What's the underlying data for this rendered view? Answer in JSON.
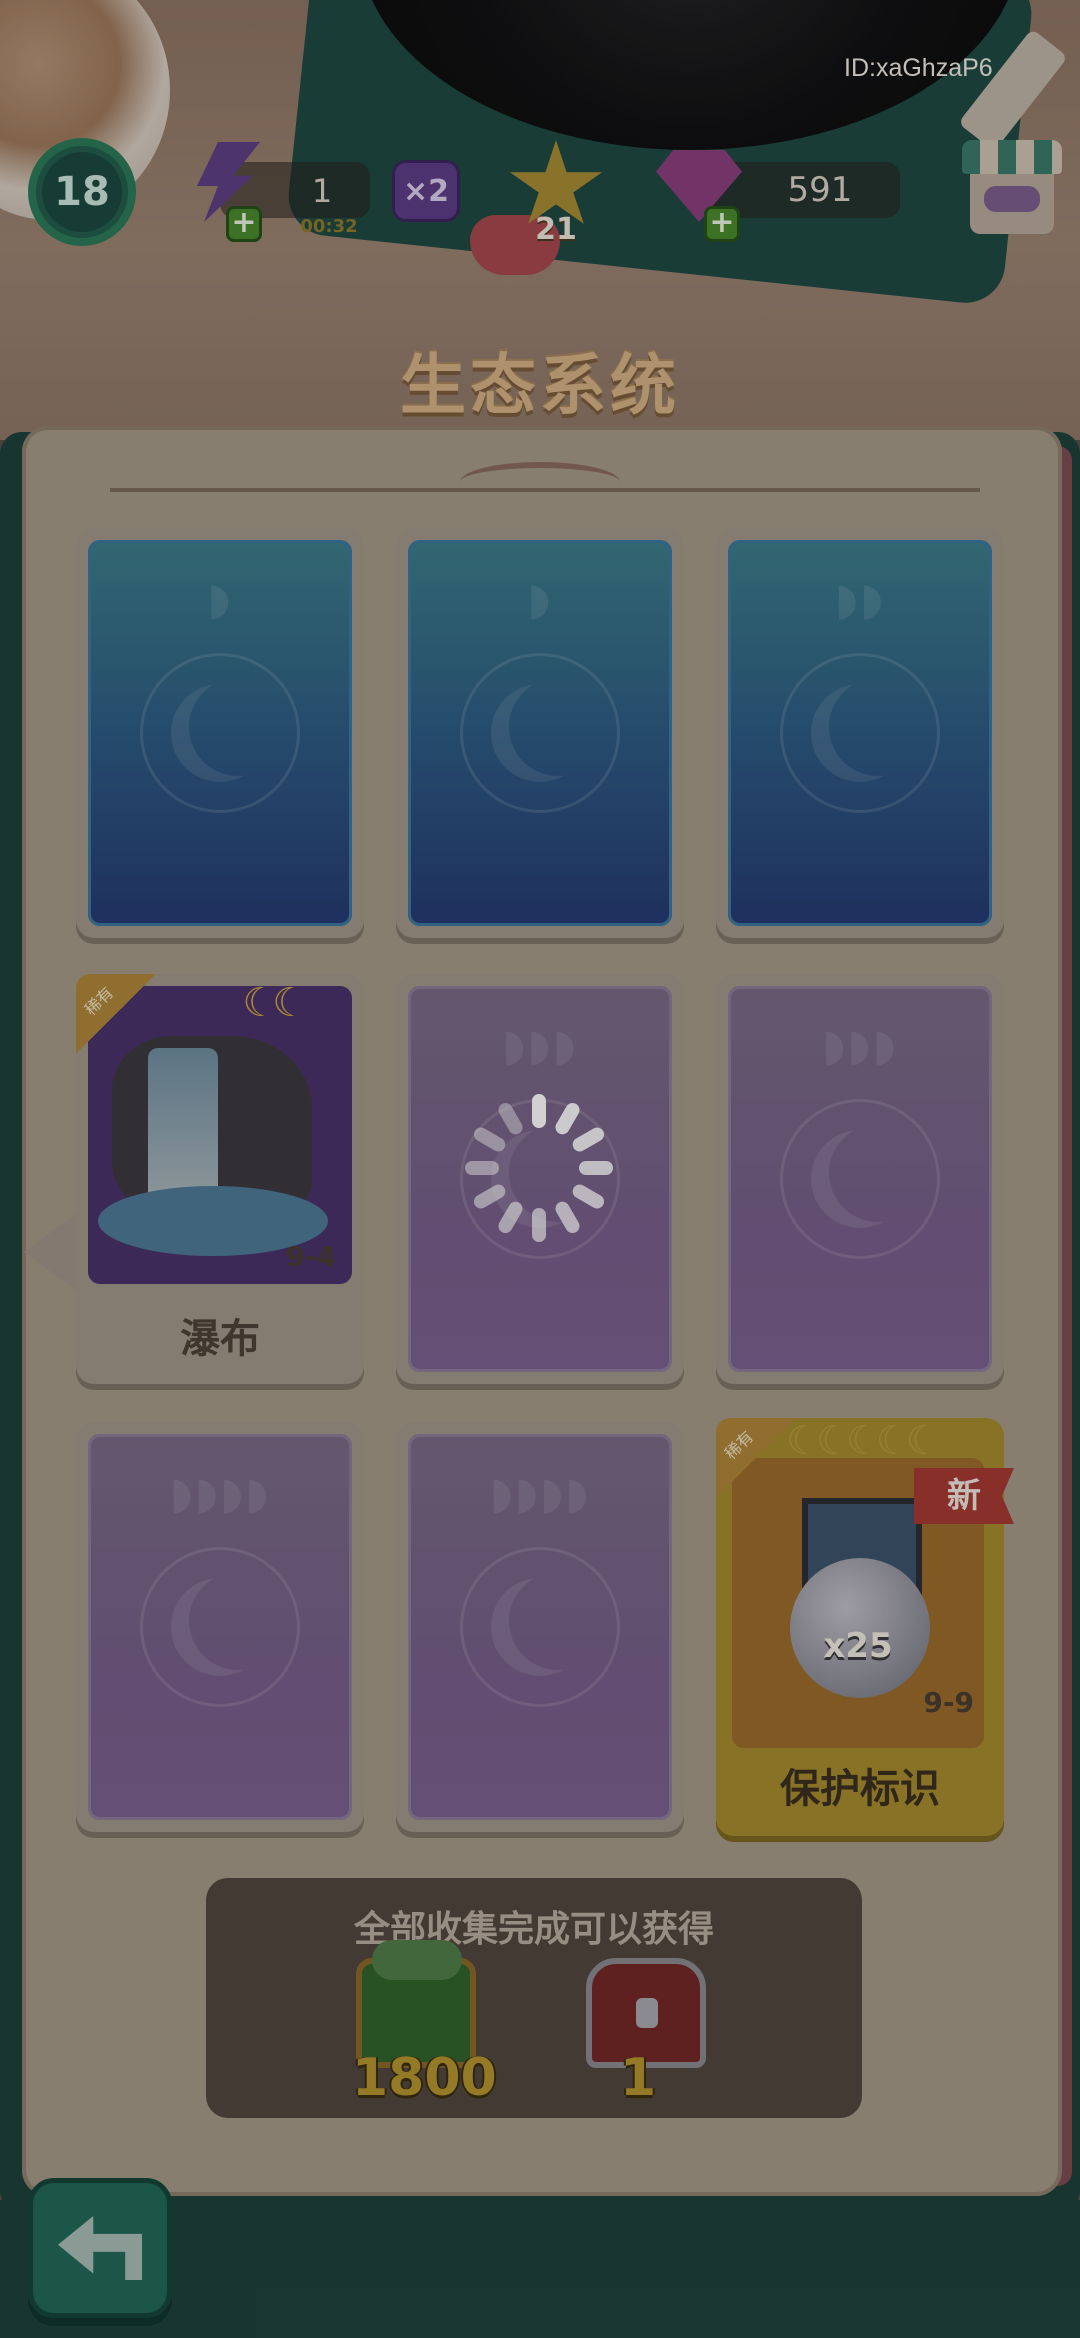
{
  "hud": {
    "user_id": "ID:xaGhzaP6",
    "level": "18",
    "energy": {
      "value": "1",
      "timer": "00:32",
      "plus": "+"
    },
    "multiplier": "×2",
    "stars": "21",
    "gems": {
      "value": "591",
      "plus": "+"
    }
  },
  "title": "生态系统",
  "cards": [
    {
      "state": "locked",
      "color": "blue",
      "moons": "◗"
    },
    {
      "state": "locked",
      "color": "blue",
      "moons": "◗"
    },
    {
      "state": "locked",
      "color": "blue",
      "moons": "◗◗"
    },
    {
      "state": "collected",
      "name": "瀑布",
      "code": "9-4",
      "moons": "☾☾",
      "tag": "稀有"
    },
    {
      "state": "loading",
      "color": "purple",
      "moons": "◗◗◗"
    },
    {
      "state": "locked",
      "color": "purple",
      "moons": "◗◗◗"
    },
    {
      "state": "locked",
      "color": "purple",
      "moons": "◗◗◗◗"
    },
    {
      "state": "locked",
      "color": "purple",
      "moons": "◗◗◗◗"
    },
    {
      "state": "new",
      "name": "保护标识",
      "code": "9-9",
      "moons": "☾☾☾☾☾",
      "tag": "稀有",
      "badge": "新",
      "item_count": "x25"
    }
  ],
  "reward": {
    "title": "全部收集完成可以获得",
    "items": [
      {
        "icon": "cash-chest-icon",
        "amount": "1800"
      },
      {
        "icon": "red-chest-icon",
        "amount": "1"
      }
    ]
  },
  "colors": {
    "book_green": "#1e423a",
    "page": "#a69a88",
    "title": "#d5b185",
    "gold": "#b5952f"
  }
}
